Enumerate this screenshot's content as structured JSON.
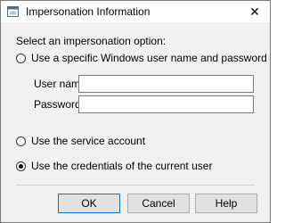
{
  "window": {
    "title": "Impersonation Information",
    "close_glyph": "✕"
  },
  "dialog": {
    "prompt": "Select an impersonation option:",
    "options": [
      {
        "label": "Use a specific Windows user name and password",
        "selected": false
      },
      {
        "label": "Use the service account",
        "selected": false
      },
      {
        "label": "Use the credentials of the current user",
        "selected": true
      }
    ],
    "username": {
      "label": "User name:",
      "value": ""
    },
    "password": {
      "label": "Password:",
      "value": ""
    }
  },
  "buttons": {
    "ok": "OK",
    "cancel": "Cancel",
    "help": "Help"
  },
  "colors": {
    "accent": "#0078d7",
    "dialog_bg": "#f0f0f0"
  }
}
